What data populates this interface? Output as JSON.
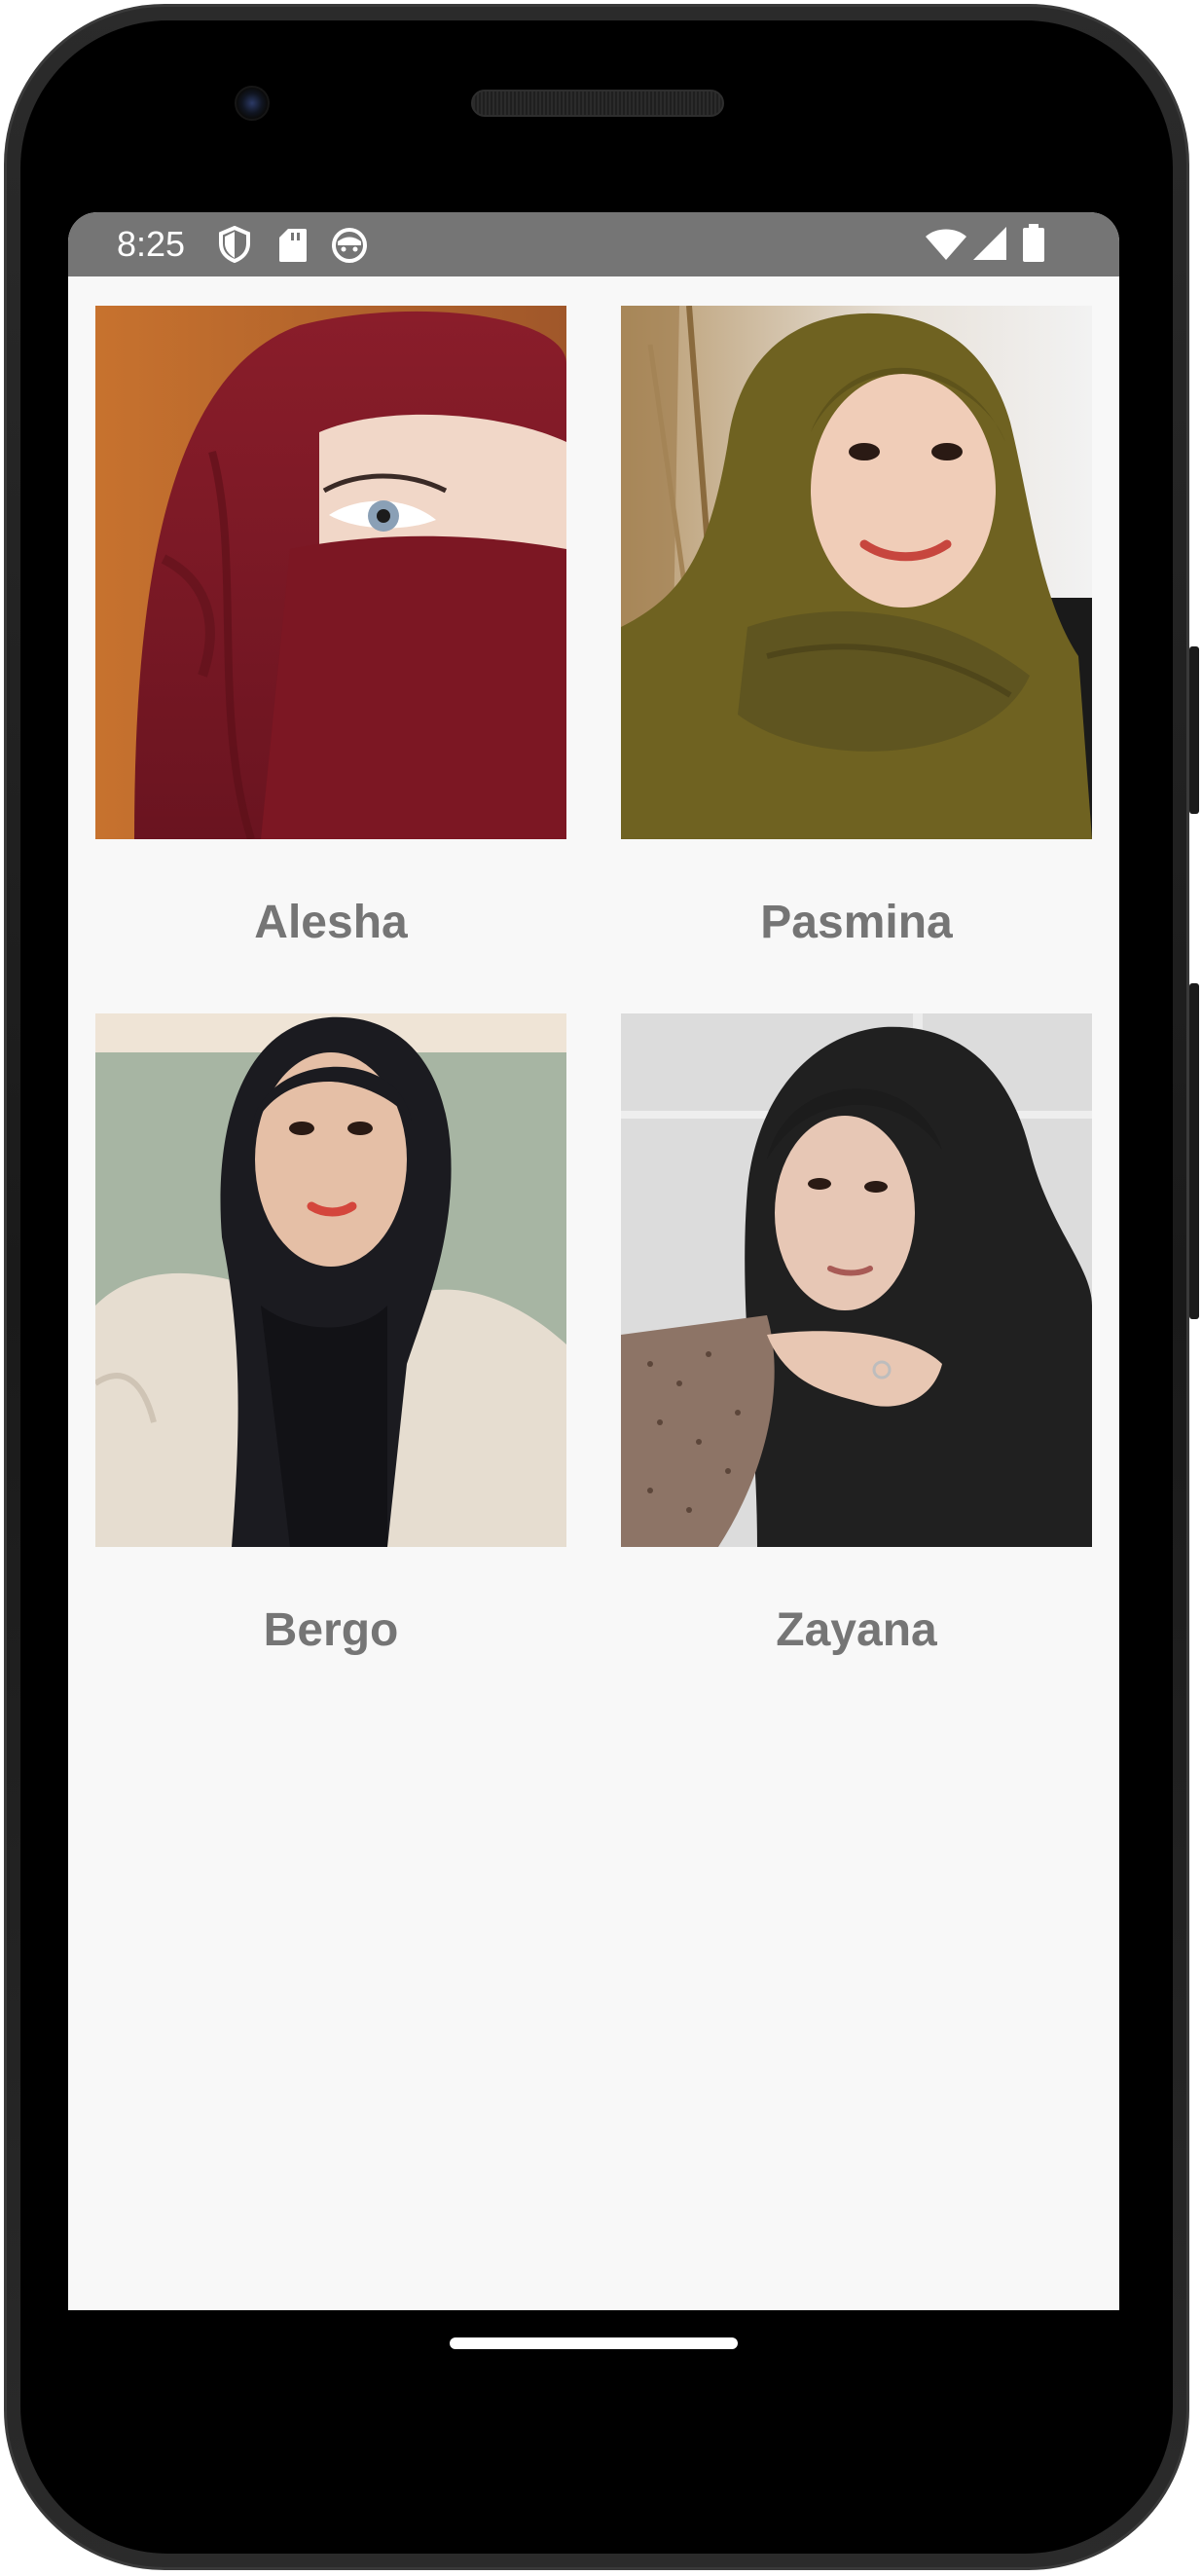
{
  "status_bar": {
    "time": "8:25",
    "left_icons": [
      "shield-icon",
      "sd-card-icon",
      "face-icon"
    ],
    "right_icons": [
      "wifi-icon",
      "cellular-signal-icon",
      "battery-icon"
    ],
    "background_color": "#757575"
  },
  "grid": {
    "items": [
      {
        "label": "Alesha",
        "image": "maroon hijab with niqab portrait"
      },
      {
        "label": "Pasmina",
        "image": "olive hijab smiling portrait"
      },
      {
        "label": "Bergo",
        "image": "black hijab with cream cardigan portrait"
      },
      {
        "label": "Zayana",
        "image": "black hijab with patterned sleeve portrait"
      }
    ],
    "label_color": "#757575",
    "background_color": "#f8f8f8"
  }
}
